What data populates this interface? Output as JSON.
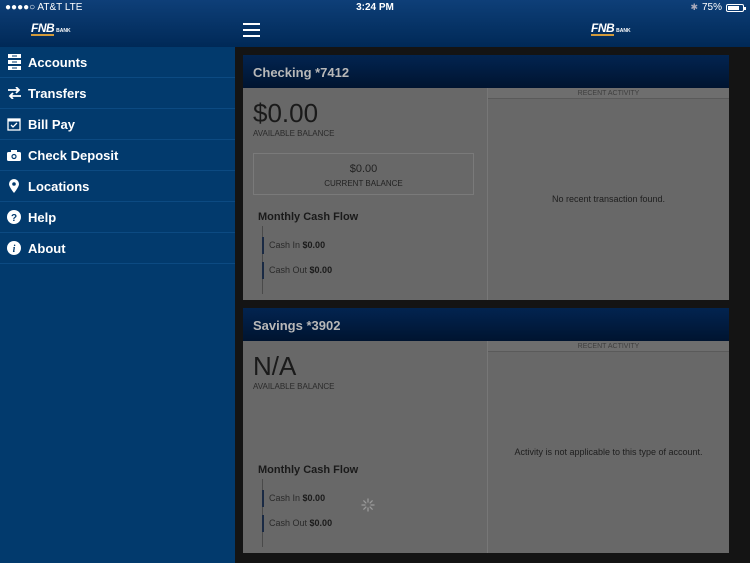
{
  "status_bar": {
    "carrier": "●●●●○ AT&T  LTE",
    "time": "3:24 PM",
    "battery_percent": "75%",
    "battery_level": 0.75
  },
  "header": {
    "logo_main": "FNB",
    "logo_sub": "BANK",
    "menu_icon": "hamburger-icon"
  },
  "sidebar": {
    "items": [
      {
        "label": "Accounts",
        "icon": "accounts-icon"
      },
      {
        "label": "Transfers",
        "icon": "transfer-arrows-icon"
      },
      {
        "label": "Bill Pay",
        "icon": "calendar-check-icon"
      },
      {
        "label": "Check Deposit",
        "icon": "camera-icon"
      },
      {
        "label": "Locations",
        "icon": "map-pin-icon"
      },
      {
        "label": "Help",
        "icon": "question-icon"
      },
      {
        "label": "About",
        "icon": "info-icon"
      }
    ]
  },
  "accounts": [
    {
      "title": "Checking *7412",
      "available_balance": "$0.00",
      "available_label": "AVAILABLE BALANCE",
      "current_balance": "$0.00",
      "current_label": "CURRENT BALANCE",
      "cash_flow_title": "Monthly Cash Flow",
      "cash_in_label": "Cash In",
      "cash_in_value": "$0.00",
      "cash_out_label": "Cash Out",
      "cash_out_value": "$0.00",
      "recent_activity_header": "RECENT ACTIVITY",
      "recent_activity_message": "No recent transaction found."
    },
    {
      "title": "Savings *3902",
      "available_balance": "N/A",
      "available_label": "AVAILABLE BALANCE",
      "cash_flow_title": "Monthly Cash Flow",
      "cash_in_label": "Cash In",
      "cash_in_value": "$0.00",
      "cash_out_label": "Cash Out",
      "cash_out_value": "$0.00",
      "recent_activity_header": "RECENT ACTIVITY",
      "recent_activity_message": "Activity is not applicable to this type of account."
    }
  ]
}
